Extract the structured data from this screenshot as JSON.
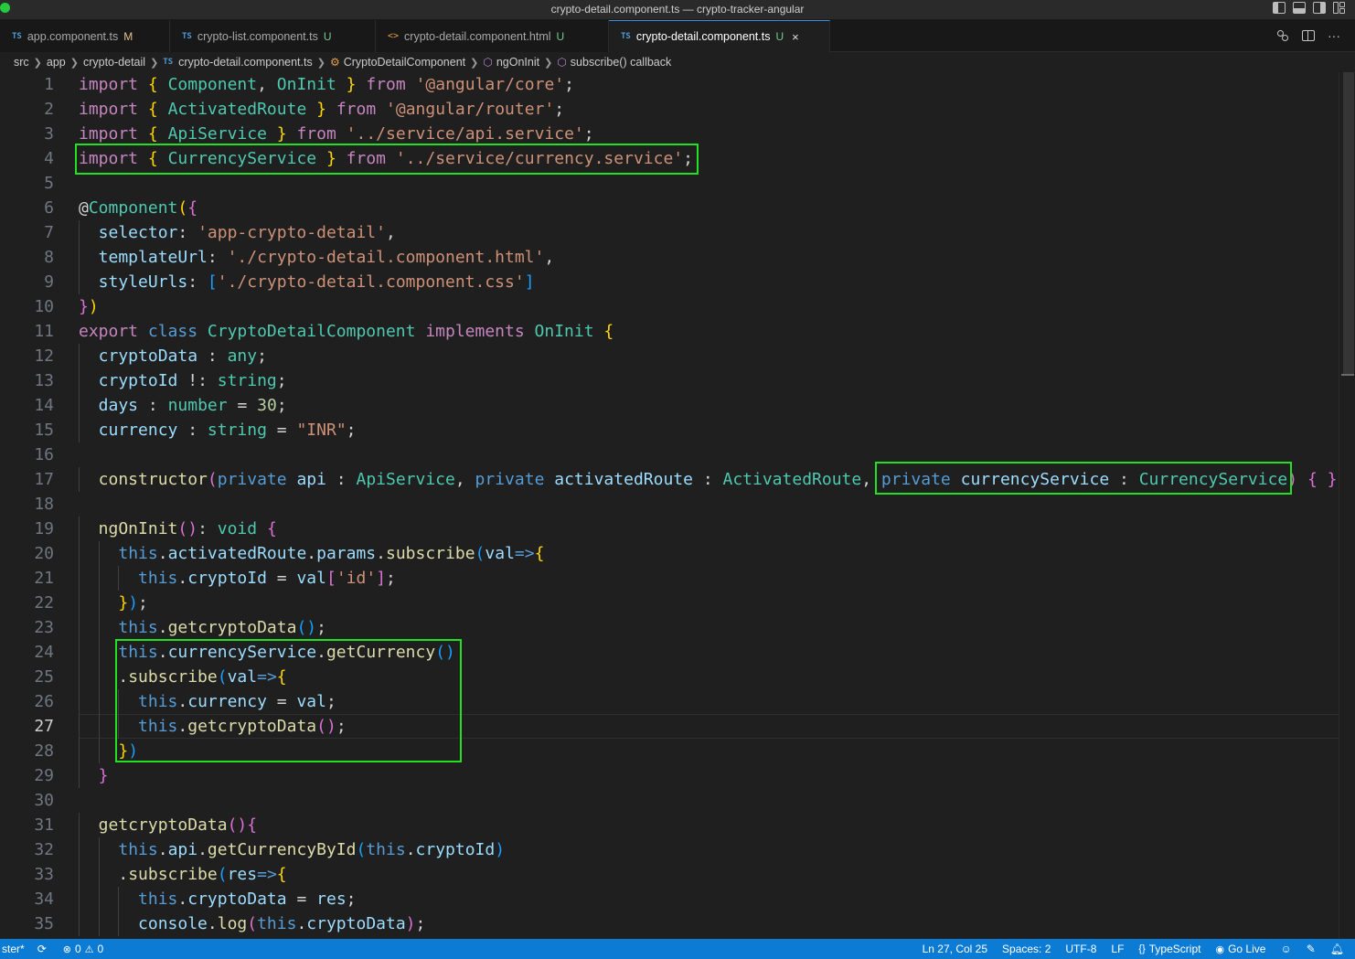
{
  "window": {
    "title": "crypto-detail.component.ts — crypto-tracker-angular"
  },
  "tabs": [
    {
      "icon": "TS",
      "label": "app.component.ts",
      "status": "M"
    },
    {
      "icon": "TS",
      "label": "crypto-list.component.ts",
      "status": "U"
    },
    {
      "icon": "<>",
      "label": "crypto-detail.component.html",
      "status": "U"
    },
    {
      "icon": "TS",
      "label": "crypto-detail.component.ts",
      "status": "U",
      "close": "×"
    }
  ],
  "breadcrumb": {
    "items": [
      "src",
      "app",
      "crypto-detail",
      "crypto-detail.component.ts",
      "CryptoDetailComponent",
      "ngOnInit",
      "subscribe() callback"
    ],
    "ts_badge": "TS"
  },
  "editor": {
    "language": "TypeScript",
    "current_line": 27,
    "line_numbers": [
      1,
      2,
      3,
      4,
      5,
      6,
      7,
      8,
      9,
      10,
      11,
      12,
      13,
      14,
      15,
      16,
      17,
      18,
      19,
      20,
      21,
      22,
      23,
      24,
      25,
      26,
      27,
      28,
      29,
      30,
      31,
      32,
      33,
      34,
      35
    ],
    "lines": [
      "import { Component, OnInit } from '@angular/core';",
      "import { ActivatedRoute } from '@angular/router';",
      "import { ApiService } from '../service/api.service';",
      "import { CurrencyService } from '../service/currency.service';",
      "",
      "@Component({",
      "  selector: 'app-crypto-detail',",
      "  templateUrl: './crypto-detail.component.html',",
      "  styleUrls: ['./crypto-detail.component.css']",
      "})",
      "export class CryptoDetailComponent implements OnInit {",
      "  cryptoData : any;",
      "  cryptoId !: string;",
      "  days : number = 30;",
      "  currency : string = \"INR\";",
      "",
      "  constructor(private api : ApiService, private activatedRoute : ActivatedRoute, private currencyService : CurrencyService) { }",
      "",
      "  ngOnInit(): void {",
      "    this.activatedRoute.params.subscribe(val=>{",
      "      this.cryptoId = val['id'];",
      "    });",
      "    this.getcryptoData();",
      "    this.currencyService.getCurrency()",
      "    .subscribe(val=>{",
      "      this.currency = val;",
      "      this.getcryptoData();",
      "    })",
      "  }",
      "",
      "  getcryptoData(){",
      "    this.api.getCurrencyById(this.cryptoId)",
      "    .subscribe(res=>{",
      "      this.cryptoData = res;",
      "      console.log(this.cryptoData);"
    ]
  },
  "statusbar": {
    "branch": "ster*",
    "errors": "0",
    "warnings": "0",
    "position": "Ln 27, Col 25",
    "spaces": "Spaces: 2",
    "encoding": "UTF-8",
    "eol": "LF",
    "language": "TypeScript",
    "golive": "Go Live"
  },
  "colors": {
    "highlight_box": "#22e022",
    "statusbar_bg": "#0b7bd4",
    "editor_bg": "#1f1f1f"
  }
}
